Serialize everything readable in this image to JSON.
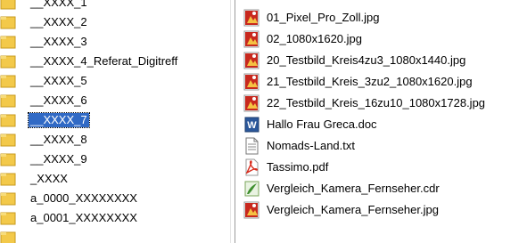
{
  "tree": {
    "items": [
      {
        "label": "__XXXX_1"
      },
      {
        "label": "__XXXX_2"
      },
      {
        "label": "__XXXX_3"
      },
      {
        "label": "__XXXX_4_Referat_Digitreff"
      },
      {
        "label": "__XXXX_5"
      },
      {
        "label": "__XXXX_6"
      },
      {
        "label": "__XXXX_7",
        "selected": true
      },
      {
        "label": "__XXXX_8"
      },
      {
        "label": "__XXXX_9"
      },
      {
        "label": "_XXXX"
      },
      {
        "label": "a_0000_XXXXXXXX"
      },
      {
        "label": "a_0001_XXXXXXXX"
      }
    ]
  },
  "files": {
    "items": [
      {
        "label": "01_Pixel_Pro_Zoll.jpg",
        "icon": "jpg-icon"
      },
      {
        "label": "02_1080x1620.jpg",
        "icon": "jpg-icon"
      },
      {
        "label": "20_Testbild_Kreis4zu3_1080x1440.jpg",
        "icon": "jpg-icon"
      },
      {
        "label": "21_Testbild_Kreis_3zu2_1080x1620.jpg",
        "icon": "jpg-icon"
      },
      {
        "label": "22_Testbild_Kreis_16zu10_1080x1728.jpg",
        "icon": "jpg-icon"
      },
      {
        "label": "Hallo Frau Greca.doc",
        "icon": "word-doc-icon"
      },
      {
        "label": "Nomads-Land.txt",
        "icon": "text-file-icon"
      },
      {
        "label": "Tassimo.pdf",
        "icon": "pdf-icon"
      },
      {
        "label": "Vergleich_Kamera_Fernseher.cdr",
        "icon": "coreldraw-icon"
      },
      {
        "label": "Vergleich_Kamera_Fernseher.jpg",
        "icon": "jpg-icon"
      }
    ]
  },
  "colors": {
    "folder": "#f3c94a",
    "selection": "#316ac5",
    "jpg_red": "#c8281e",
    "word_blue": "#2b579a"
  }
}
